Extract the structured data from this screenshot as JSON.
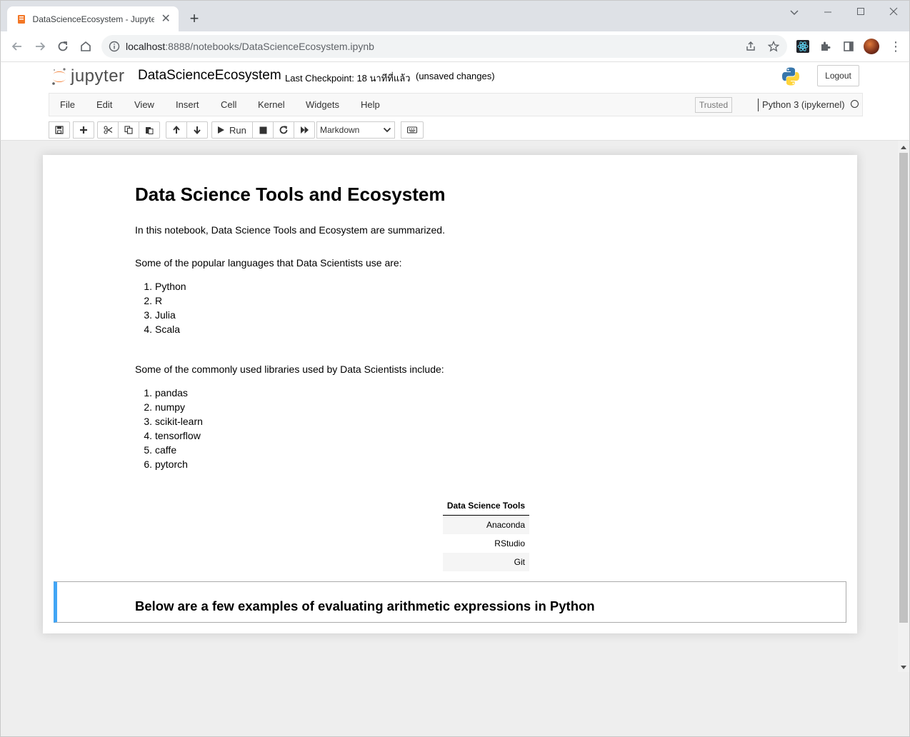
{
  "browser": {
    "tab_title": "DataScienceEcosystem - Jupyter Notebook",
    "url_host": "localhost",
    "url_rest": ":8888/notebooks/DataScienceEcosystem.ipynb"
  },
  "jupyter": {
    "logo_text": "jupyter",
    "notebook_name": "DataScienceEcosystem",
    "checkpoint": "Last Checkpoint: 18 นาทีที่แล้ว",
    "unsaved": "(unsaved changes)",
    "logout_label": "Logout",
    "menu": [
      "File",
      "Edit",
      "View",
      "Insert",
      "Cell",
      "Kernel",
      "Widgets",
      "Help"
    ],
    "trusted_label": "Trusted",
    "kernel_name": "Python 3 (ipykernel)",
    "run_label": "Run",
    "cell_type": "Markdown"
  },
  "notebook": {
    "title": "Data Science Tools and Ecosystem",
    "intro": "In this notebook, Data Science Tools and Ecosystem are summarized.",
    "languages_intro": "Some of the popular languages that Data Scientists use are:",
    "languages": [
      "Python",
      "R",
      "Julia",
      "Scala"
    ],
    "libraries_intro": "Some of the commonly used libraries used by Data Scientists include:",
    "libraries": [
      "pandas",
      "numpy",
      "scikit-learn",
      "tensorflow",
      "caffe",
      "pytorch"
    ],
    "table_header": "Data Science Tools",
    "tools": [
      "Anaconda",
      "RStudio",
      "Git"
    ],
    "selected_cell_heading": "Below are a few examples of evaluating arithmetic expressions in Python"
  },
  "icons": {
    "tab_favicon": "jupyter-book-icon",
    "accent": "#42a5f5",
    "jupyter_orange": "#f37726"
  }
}
